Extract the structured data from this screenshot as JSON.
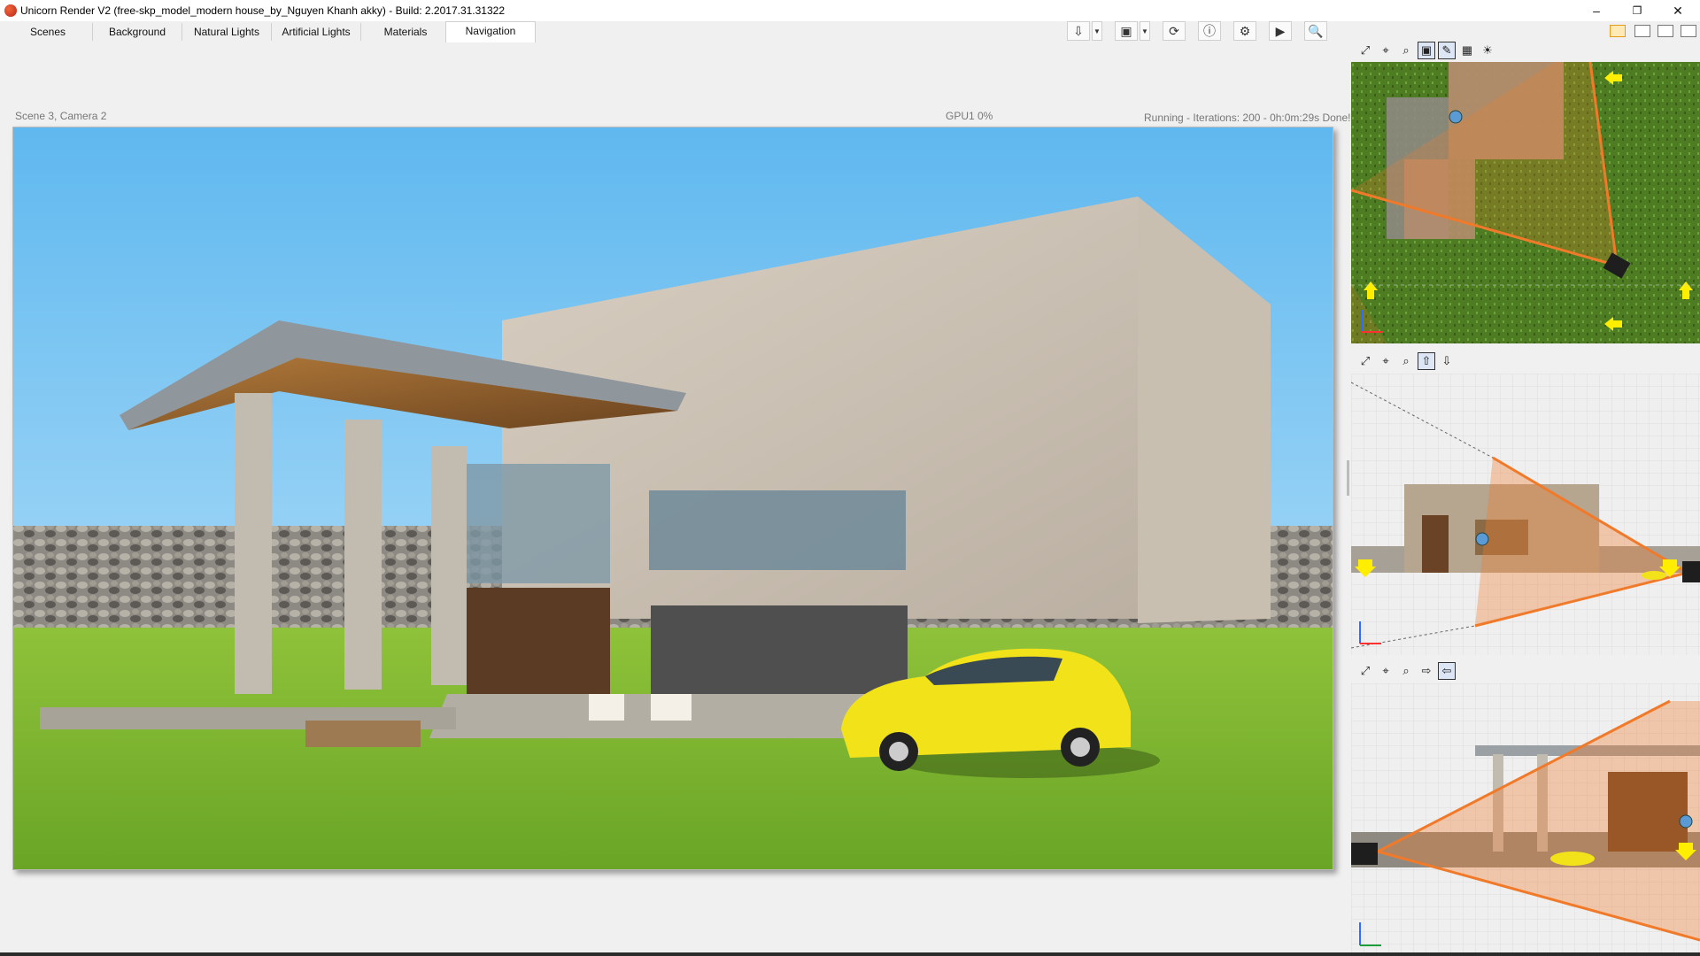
{
  "window": {
    "title": "Unicorn Render V2 (free-skp_model_modern house_by_Nguyen Khanh akky) - Build: 2.2017.31.31322",
    "minimize": "–",
    "restore": "❐",
    "close": "✕"
  },
  "tabs": [
    {
      "label": "Scenes"
    },
    {
      "label": "Background"
    },
    {
      "label": "Natural Lights"
    },
    {
      "label": "Artificial Lights"
    },
    {
      "label": "Materials"
    },
    {
      "label": "Navigation"
    }
  ],
  "status": {
    "scene_camera": "Scene 3, Camera 2",
    "gpu": "GPU1 0%",
    "progress": "Running - Iterations: 200 - 0h:0m:29s Done!"
  },
  "colors": {
    "sky_top": "#5fb8ef",
    "sky_bottom": "#c3e6fb",
    "grass": "#7fb431",
    "car": "#f2e21a",
    "camera_frustum": "#f07a2a",
    "marker": "#5b9bd5"
  }
}
